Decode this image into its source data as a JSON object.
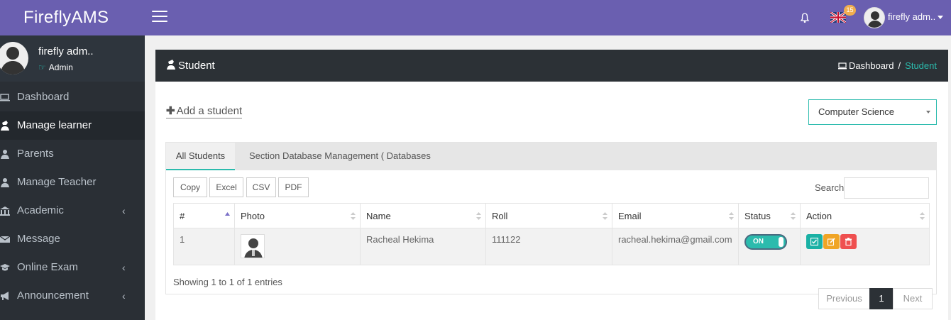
{
  "app": {
    "brand": "FireflyAMS",
    "notification_badge": "15",
    "user_name": "firefly adm..",
    "accent_color": "#6a5fb0",
    "teal_color": "#2bbbad"
  },
  "sidebar": {
    "profile": {
      "name": "firefly adm..",
      "role": "Admin"
    },
    "items": [
      {
        "label": "Dashboard",
        "icon": "laptop-icon",
        "active": false,
        "has_arrow": false
      },
      {
        "label": "Manage learner",
        "icon": "student-icon",
        "active": true,
        "has_arrow": false
      },
      {
        "label": "Parents",
        "icon": "user-icon",
        "active": false,
        "has_arrow": false
      },
      {
        "label": "Manage Teacher",
        "icon": "teacher-icon",
        "active": false,
        "has_arrow": false
      },
      {
        "label": "Academic",
        "icon": "institution-icon",
        "active": false,
        "has_arrow": true
      },
      {
        "label": "Message",
        "icon": "envelope-icon",
        "active": false,
        "has_arrow": false
      },
      {
        "label": "Online Exam",
        "icon": "graduation-cap-icon",
        "active": false,
        "has_arrow": true
      },
      {
        "label": "Announcement",
        "icon": "bullhorn-icon",
        "active": false,
        "has_arrow": true
      }
    ],
    "arrow_glyph": "‹"
  },
  "panel": {
    "title": "Student",
    "breadcrumb": {
      "home": "Dashboard",
      "separator": "/",
      "current": "Student"
    }
  },
  "toolbar": {
    "add_student": "Add a student",
    "class_select": "Computer Science"
  },
  "tabs": [
    "All Students",
    "Section Database Management ( Databases )"
  ],
  "export_buttons": [
    "Copy",
    "Excel",
    "CSV",
    "PDF"
  ],
  "search": {
    "label": "Search:",
    "value": ""
  },
  "table": {
    "columns": [
      "#",
      "Photo",
      "Name",
      "Roll",
      "Email",
      "Status",
      "Action"
    ],
    "rows": [
      {
        "index": "1",
        "name": "Racheal Hekima",
        "roll": "111122",
        "email": "racheal.hekima@gmail.com",
        "status": "ON"
      }
    ]
  },
  "table_info": "Showing 1 to 1 of 1 entries",
  "pagination": {
    "previous": "Previous",
    "page": "1",
    "next": "Next"
  }
}
